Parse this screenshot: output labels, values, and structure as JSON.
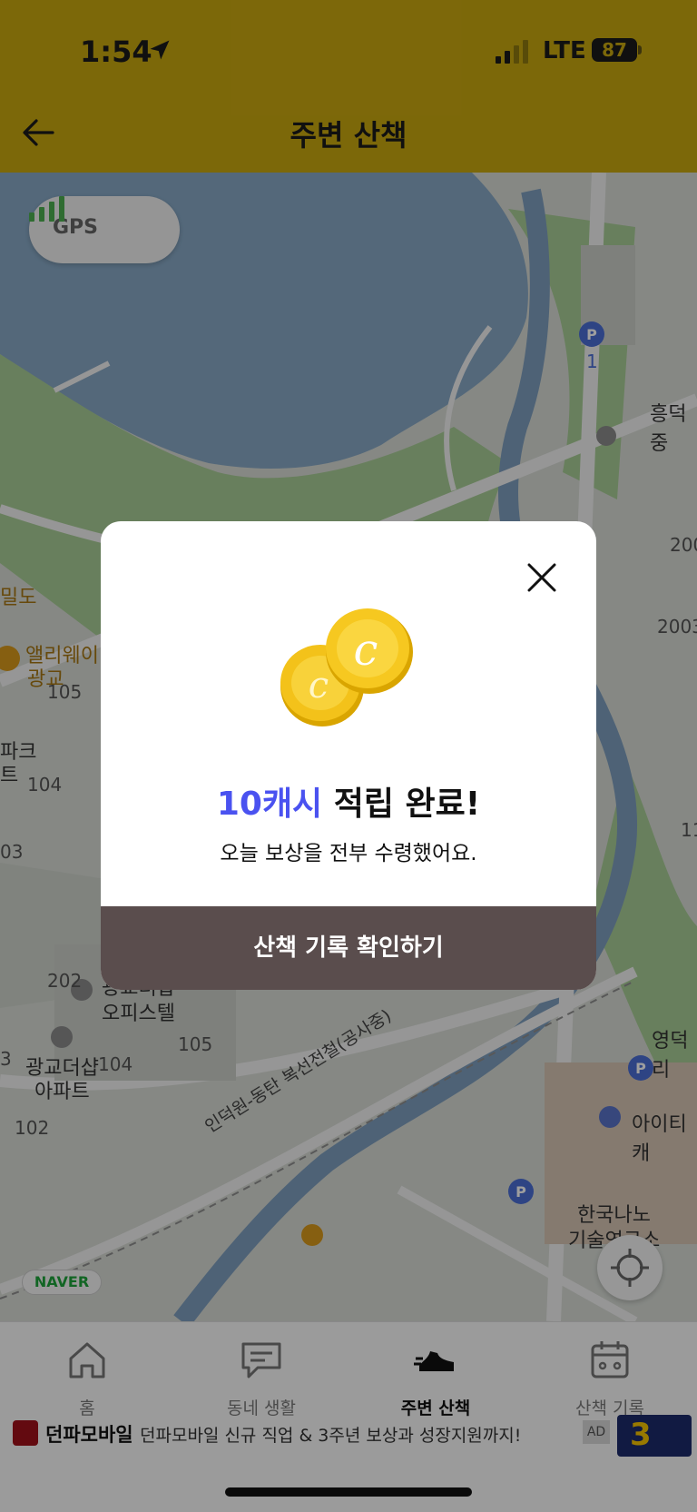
{
  "status": {
    "time": "1:54",
    "network": "LTE",
    "battery": "87"
  },
  "header": {
    "title": "주변 산책"
  },
  "map": {
    "gps_label": "GPS",
    "naver_label": "NAVER",
    "labels": {
      "l1": "흥덕중",
      "l2": "200",
      "l3": "2003",
      "l4": "1",
      "l5": "밀도",
      "l6": "앨리웨이",
      "l7": "광교",
      "l8": "105",
      "l9": "파크",
      "l10": "트",
      "l11": "104",
      "l12": "03",
      "l13": "11",
      "l14": "영덕리",
      "l15": "202",
      "l16": "광교더샵",
      "l17": "오피스텔",
      "l18": "105",
      "l19": "광교더샵",
      "l20": "아파트",
      "l21": "104",
      "l22": "3",
      "l23": "102",
      "l24": "인덕원-동탄 복선전철(공사중)",
      "l25": "아이티캐",
      "l26": "한국나노",
      "l27": "기술연구소"
    }
  },
  "modal": {
    "highlight": "10캐시",
    "headline_rest": " 적립 완료!",
    "subtitle": "오늘 보상을 전부 수령했어요.",
    "cta_label": "산책 기록 확인하기"
  },
  "tabs": [
    {
      "label": "홈",
      "icon": "home-icon"
    },
    {
      "label": "동네 생활",
      "icon": "chat-icon"
    },
    {
      "label": "주변 산책",
      "icon": "sneaker-icon",
      "active": true
    },
    {
      "label": "산책 기록",
      "icon": "calendar-icon"
    }
  ],
  "ad": {
    "brand": "던파모바일",
    "text": "던파모바일 신규 직업 & 3주년 보상과 성장지원까지!",
    "tag": "AD",
    "thumb_text": "3"
  },
  "colors": {
    "header": "#c9a810",
    "accent": "#4a52f0",
    "cta": "#5a4d4d"
  }
}
